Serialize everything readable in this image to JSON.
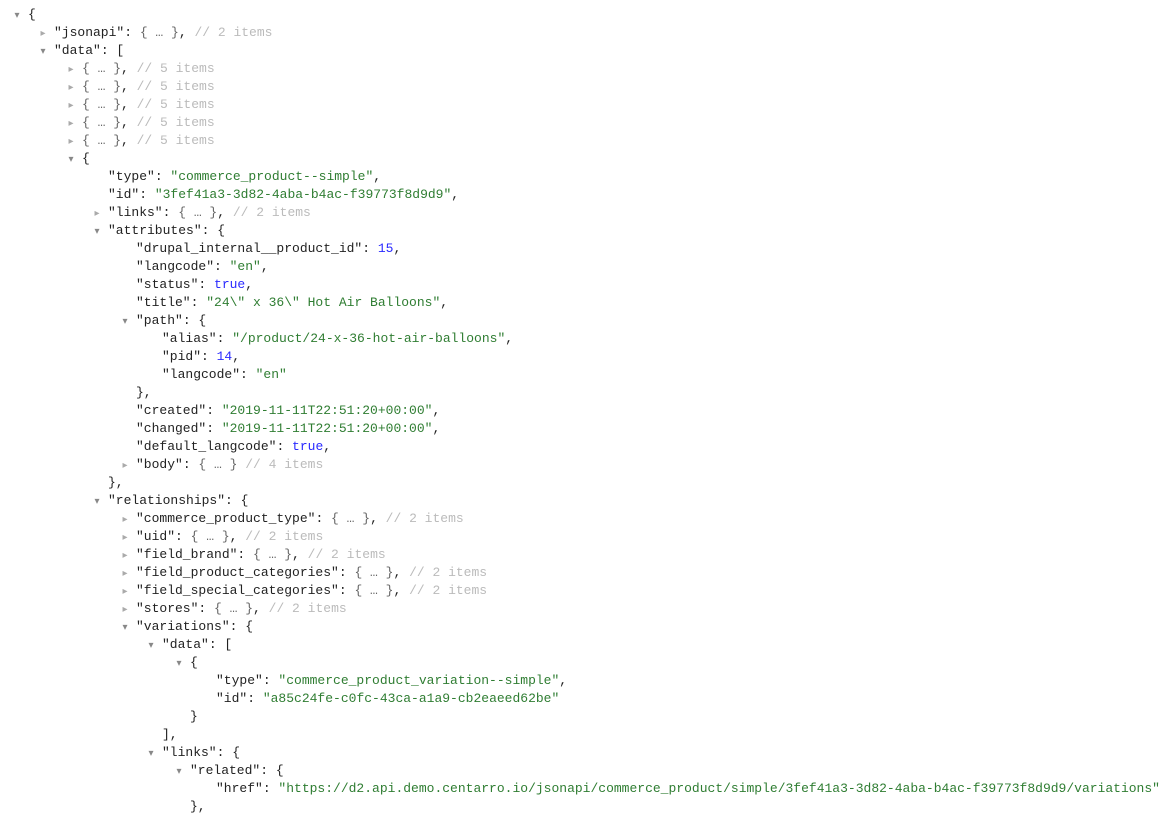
{
  "ind": {
    "L0": 28,
    "L1": 54,
    "L2": 82,
    "L3": 108,
    "L4": 136,
    "L5": 162,
    "L6": 190,
    "L7": 216
  },
  "caretOffset": -16,
  "labels": {
    "jsonapi": "\"jsonapi\"",
    "data": "\"data\"",
    "type": "\"type\"",
    "id": "\"id\"",
    "links": "\"links\"",
    "attributes": "\"attributes\"",
    "drupal_pid": "\"drupal_internal__product_id\"",
    "langcode": "\"langcode\"",
    "status": "\"status\"",
    "title": "\"title\"",
    "path": "\"path\"",
    "alias": "\"alias\"",
    "pid": "\"pid\"",
    "created": "\"created\"",
    "changed": "\"changed\"",
    "default_langcode": "\"default_langcode\"",
    "body": "\"body\"",
    "relationships": "\"relationships\"",
    "commerce_product_type": "\"commerce_product_type\"",
    "uid": "\"uid\"",
    "field_brand": "\"field_brand\"",
    "field_product_categories": "\"field_product_categories\"",
    "field_special_categories": "\"field_special_categories\"",
    "stores": "\"stores\"",
    "variations": "\"variations\"",
    "related": "\"related\"",
    "href": "\"href\""
  },
  "values": {
    "type_simple": "\"commerce_product--simple\"",
    "id_simple": "\"3fef41a3-3d82-4aba-b4ac-f39773f8d9d9\"",
    "drupal_pid": "15",
    "langcode": "\"en\"",
    "status": "true",
    "title": "\"24\\\" x 36\\\" Hot Air Balloons\"",
    "alias": "\"/product/24-x-36-hot-air-balloons\"",
    "pid": "14",
    "path_langcode": "\"en\"",
    "created": "\"2019-11-11T22:51:20+00:00\"",
    "changed": "\"2019-11-11T22:51:20+00:00\"",
    "default_langcode": "true",
    "var_type": "\"commerce_product_variation--simple\"",
    "var_id": "\"a85c24fe-c0fc-43ca-a1a9-cb2eaeed62be\"",
    "href": "\"https://d2.api.demo.centarro.io/jsonapi/commerce_product/simple/3fef41a3-3d82-4aba-b4ac-f39773f8d9d9/variations\""
  },
  "stubs": {
    "obj": "{ … }",
    "arr_open": "[",
    "open_brace": "{",
    "close_brace": "}",
    "close_brace_comma": "},",
    "close_bracket_comma": "],"
  },
  "comments": {
    "items2": "// 2 items",
    "items4": "// 4 items",
    "items5": "// 5 items"
  }
}
